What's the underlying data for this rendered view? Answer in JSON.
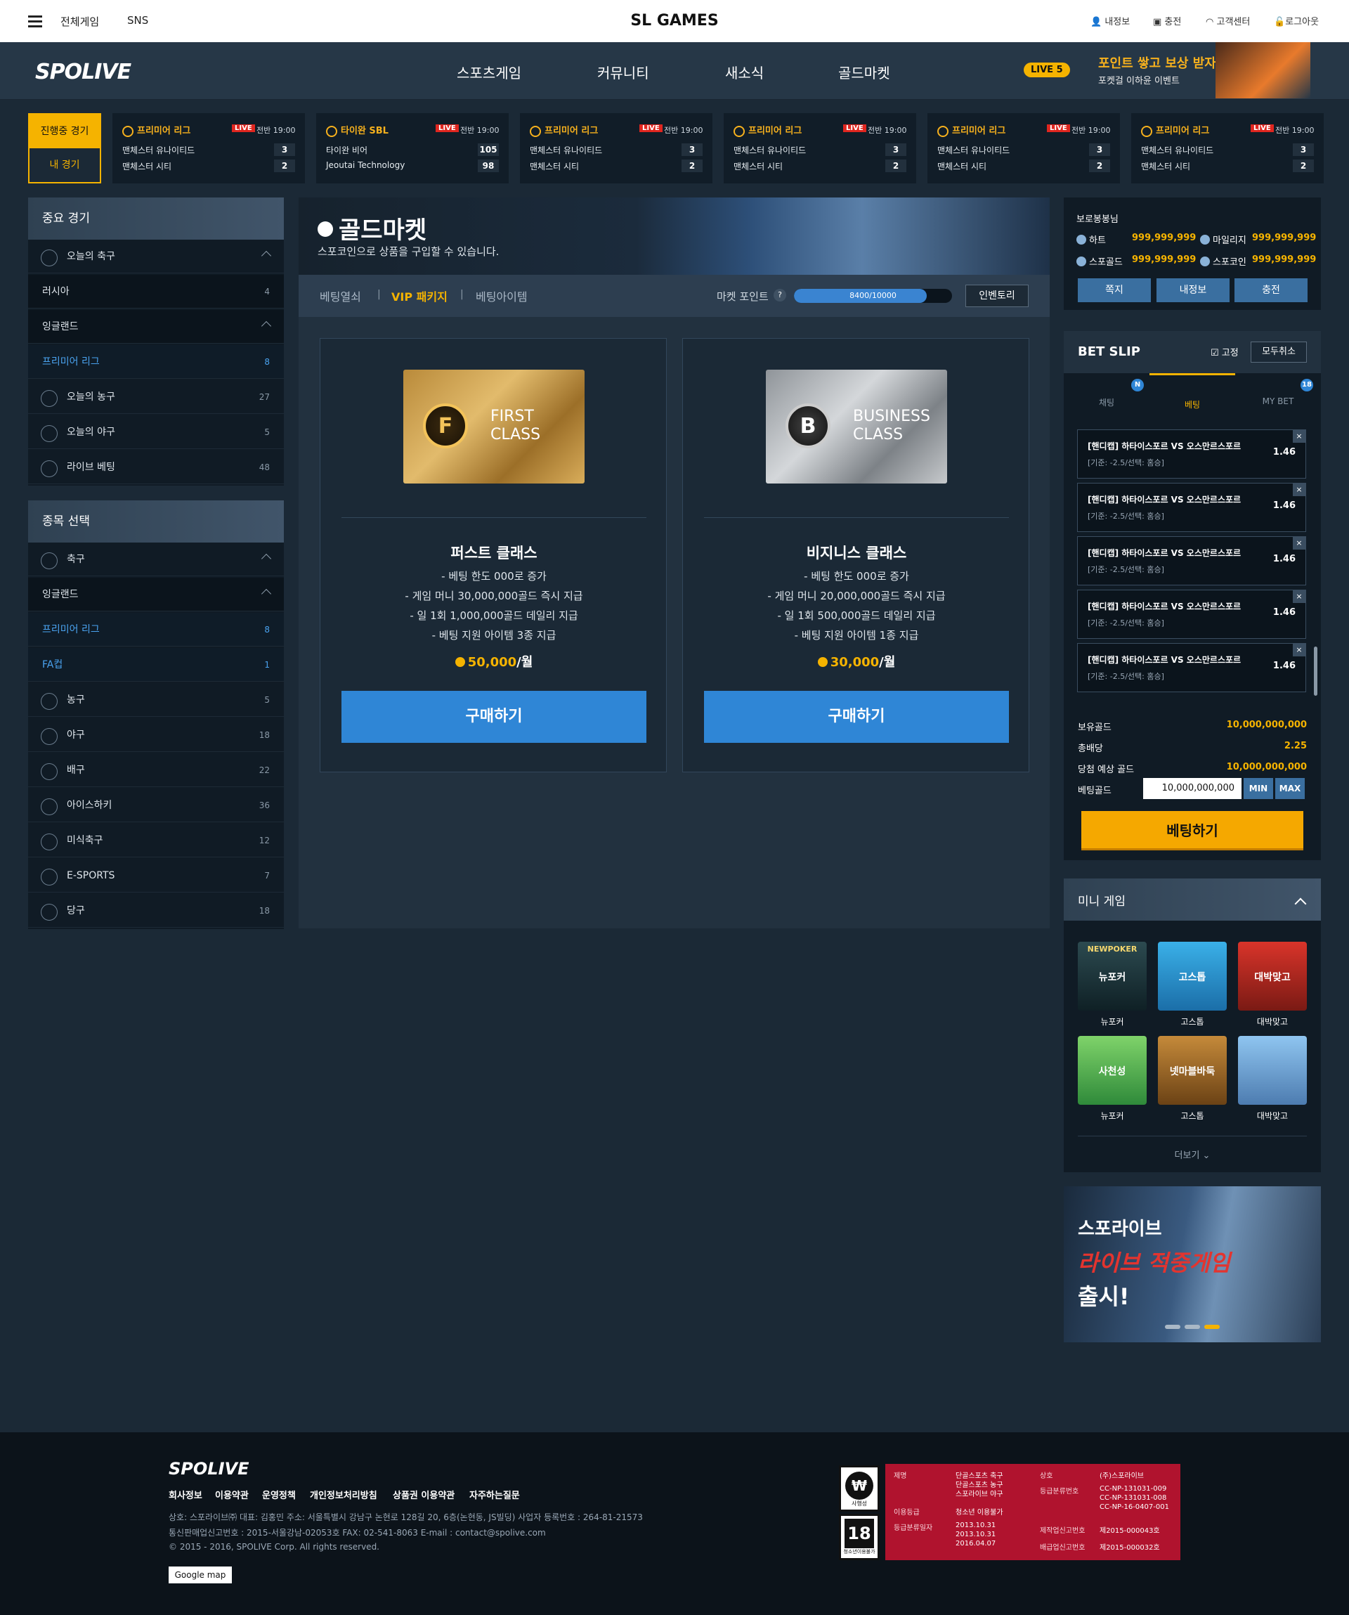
{
  "topbar": {
    "menu_label": "전체게임",
    "sns_label": "SNS",
    "title": "SL GAMES",
    "links": [
      "내정보",
      "충전",
      "고객센터",
      "로그아웃"
    ]
  },
  "nav": {
    "logo": "SPOLIVE",
    "items": [
      "스포츠게임",
      "커뮤니티",
      "새소식",
      "골드마켓"
    ],
    "live_badge": "LIVE 5",
    "promo_title": "포인트 쌓고 보상 받자!",
    "promo_sub": "포켓걸 이하윤 이벤트"
  },
  "live_tabs": {
    "active": "진행중 경기",
    "mine": "내 경기"
  },
  "matches": [
    {
      "league": "프리미어 리그",
      "live": "LIVE",
      "time": "전반 19:00",
      "home": "맨체스터 유나이티드",
      "away": "맨체스터 시티",
      "s1": "3",
      "s2": "2"
    },
    {
      "league": "타이완 SBL",
      "live": "LIVE",
      "time": "전반 19:00",
      "home": "타이완 비어",
      "away": "Jeoutai Technology",
      "s1": "105",
      "s2": "98"
    },
    {
      "league": "프리미어 리그",
      "live": "LIVE",
      "time": "전반 19:00",
      "home": "맨체스터 유나이티드",
      "away": "맨체스터 시티",
      "s1": "3",
      "s2": "2"
    },
    {
      "league": "프리미어 리그",
      "live": "LIVE",
      "time": "전반 19:00",
      "home": "맨체스터 유나이티드",
      "away": "맨체스터 시티",
      "s1": "3",
      "s2": "2"
    },
    {
      "league": "프리미어 리그",
      "live": "LIVE",
      "time": "전반 19:00",
      "home": "맨체스터 유나이티드",
      "away": "맨체스터 시티",
      "s1": "3",
      "s2": "2"
    },
    {
      "league": "프리미어 리그",
      "live": "LIVE",
      "time": "전반 19:00",
      "home": "맨체스터 유나이티드",
      "away": "맨체스터 시티",
      "s1": "3",
      "s2": "2"
    }
  ],
  "important": {
    "title": "중요 경기",
    "rows": [
      {
        "label": "오늘의 축구",
        "count": "",
        "kind": "head"
      },
      {
        "label": "러시아",
        "count": "4",
        "kind": "dark"
      },
      {
        "label": "잉글랜드",
        "count": "",
        "kind": "darkchev"
      },
      {
        "label": "프리미어 리그",
        "count": "8",
        "kind": "sel"
      },
      {
        "label": "오늘의 농구",
        "count": "27",
        "kind": "icon"
      },
      {
        "label": "오늘의 야구",
        "count": "5",
        "kind": "icon"
      },
      {
        "label": "라이브 베팅",
        "count": "48",
        "kind": "icon"
      }
    ]
  },
  "sports": {
    "title": "종목 선택",
    "rows": [
      {
        "label": "축구",
        "count": "",
        "kind": "head"
      },
      {
        "label": "잉글랜드",
        "count": "",
        "kind": "darkchev"
      },
      {
        "label": "프리미어 리그",
        "count": "8",
        "kind": "sel"
      },
      {
        "label": "FA컵",
        "count": "1",
        "kind": "sel"
      },
      {
        "label": "농구",
        "count": "5",
        "kind": "icon"
      },
      {
        "label": "야구",
        "count": "18",
        "kind": "icon"
      },
      {
        "label": "배구",
        "count": "22",
        "kind": "icon"
      },
      {
        "label": "아이스하키",
        "count": "36",
        "kind": "icon"
      },
      {
        "label": "미식축구",
        "count": "12",
        "kind": "icon"
      },
      {
        "label": "E-SPORTS",
        "count": "7",
        "kind": "icon"
      },
      {
        "label": "당구",
        "count": "18",
        "kind": "icon"
      }
    ]
  },
  "banner": {
    "title": "골드마켓",
    "subtitle": "스포코인으로 상품을 구입할 수 있습니다."
  },
  "tabs": [
    "베팅열쇠",
    "VIP 패키지",
    "베팅아이템"
  ],
  "market_point": {
    "label": "마켓 포인트",
    "help": "?",
    "value": 8400,
    "max": 10000,
    "text": "8400/10000",
    "inventory": "인벤토리"
  },
  "cards": [
    {
      "badge": "F",
      "card_text1": "FIRST",
      "card_text2": "CLASS",
      "name": "퍼스트 클래스",
      "features": [
        "- 베팅 한도 000로 증가",
        "- 게임 머니 30,000,000골드 즉시 지급",
        "- 일 1회 1,000,000골드 데일리 지급",
        "- 베팅 지원 아이템 3종 지급"
      ],
      "price": "50,000",
      "unit": "/월",
      "buy": "구매하기"
    },
    {
      "badge": "B",
      "card_text1": "BUSINESS",
      "card_text2": "CLASS",
      "name": "비지니스 클래스",
      "features": [
        "- 베팅 한도 000로 증가",
        "- 게임 머니 20,000,000골드 즉시 지급",
        "- 일 1회 500,000골드 데일리 지급",
        "- 베팅 지원 아이템 1종 지급"
      ],
      "price": "30,000",
      "unit": "/월",
      "buy": "구매하기"
    }
  ],
  "balance": {
    "title": "보로봉봉님",
    "items": [
      {
        "label": "하트",
        "value": "999,999,999"
      },
      {
        "label": "마일리지",
        "value": "999,999,999"
      },
      {
        "label": "스포골드",
        "value": "999,999,999"
      },
      {
        "label": "스포코인",
        "value": "999,999,999"
      }
    ],
    "buttons": [
      "쪽지",
      "내정보",
      "충전"
    ]
  },
  "betslip": {
    "title": "BET SLIP",
    "fix": "고정",
    "clear": "모두취소",
    "tabs": [
      {
        "label": "채팅",
        "badge": "N"
      },
      {
        "label": "베팅",
        "badge": ""
      },
      {
        "label": "MY BET",
        "badge": "18"
      }
    ],
    "items": [
      {
        "title": "[핸디캡] 하타이스포르 VS 오스만르스포르",
        "detail": "[기준: -2.5/선택: 홈승]",
        "odds": "1.46"
      },
      {
        "title": "[핸디캡] 하타이스포르 VS 오스만르스포르",
        "detail": "[기준: -2.5/선택: 홈승]",
        "odds": "1.46"
      },
      {
        "title": "[핸디캡] 하타이스포르 VS 오스만르스포르",
        "detail": "[기준: -2.5/선택: 홈승]",
        "odds": "1.46"
      },
      {
        "title": "[핸디캡] 하타이스포르 VS 오스만르스포르",
        "detail": "[기준: -2.5/선택: 홈승]",
        "odds": "1.46"
      },
      {
        "title": "[핸디캡] 하타이스포르 VS 오스만르스포르",
        "detail": "[기준: -2.5/선택: 홈승]",
        "odds": "1.46"
      }
    ],
    "summary": [
      {
        "label": "보유골드",
        "value": "10,000,000,000"
      },
      {
        "label": "총배당",
        "value": "2.25"
      },
      {
        "label": "당첨 예상 골드",
        "value": "10,000,000,000"
      }
    ],
    "bet_label": "베팅골드",
    "bet_value": "10,000,000,000",
    "min": "MIN",
    "max": "MAX",
    "submit": "베팅하기"
  },
  "mini": {
    "title": "미니 게임",
    "games": [
      {
        "label": "뉴포커",
        "logo": "NEWPOKER",
        "art": "뉴포커"
      },
      {
        "label": "고스톱",
        "logo": "",
        "art": "고스톱"
      },
      {
        "label": "대박맞고",
        "logo": "",
        "art": "대박맞고"
      },
      {
        "label": "뉴포커",
        "logo": "",
        "art": "사천성"
      },
      {
        "label": "고스톱",
        "logo": "",
        "art": "넷마블바둑"
      },
      {
        "label": "대박맞고",
        "logo": "",
        "art": ""
      }
    ],
    "more": "더보기"
  },
  "promo2": {
    "line1": "스포라이브",
    "line2": "라이브 적중게임",
    "line3": "출시!"
  },
  "footer": {
    "logo": "SPOLIVE",
    "links": [
      "회사정보",
      "이용약관",
      "운영정책",
      "개인정보처리방침",
      "상품권 이용약관",
      "자주하는질문"
    ],
    "info1": "상호: 스포라이브㈜   대표: 김홍민   주소: 서울특별시 강남구 논현로 128길 20, 6층(논현동, JS빌딩)   사업자 등록번호 : 264-81-21573",
    "info2": "통신판매업신고번호 : 2015-서울강남-02053호   FAX: 02-541-8063   E-mail : contact@spolive.com",
    "info3": "© 2015 - 2016, SPOLIVE Corp. All rights reserved.",
    "map": "Google map",
    "rating": {
      "rate1": "사행성",
      "rate2_num": "18",
      "rate2": "청소년이용불가",
      "label_name": "제명",
      "names": [
        "단골스포츠 축구",
        "단골스포츠 농구",
        "스포라이브 야구"
      ],
      "label_grade": "이용등급",
      "grade": "청소년 이용불가",
      "label_date": "등급분류일자",
      "dates": [
        "2013.10.31",
        "2013.10.31",
        "2016.04.07"
      ],
      "label_co": "상호",
      "co": "(주)스포라이브",
      "label_num": "등급분류번호",
      "nums": [
        "CC-NP-131031-009",
        "CC-NP-131031-008",
        "CC-NP-16-0407-001"
      ],
      "label_prod": "제작업신고번호",
      "prod": "제2015-000043호",
      "label_dist": "배급업신고번호",
      "dist": "제2015-000032호"
    }
  }
}
